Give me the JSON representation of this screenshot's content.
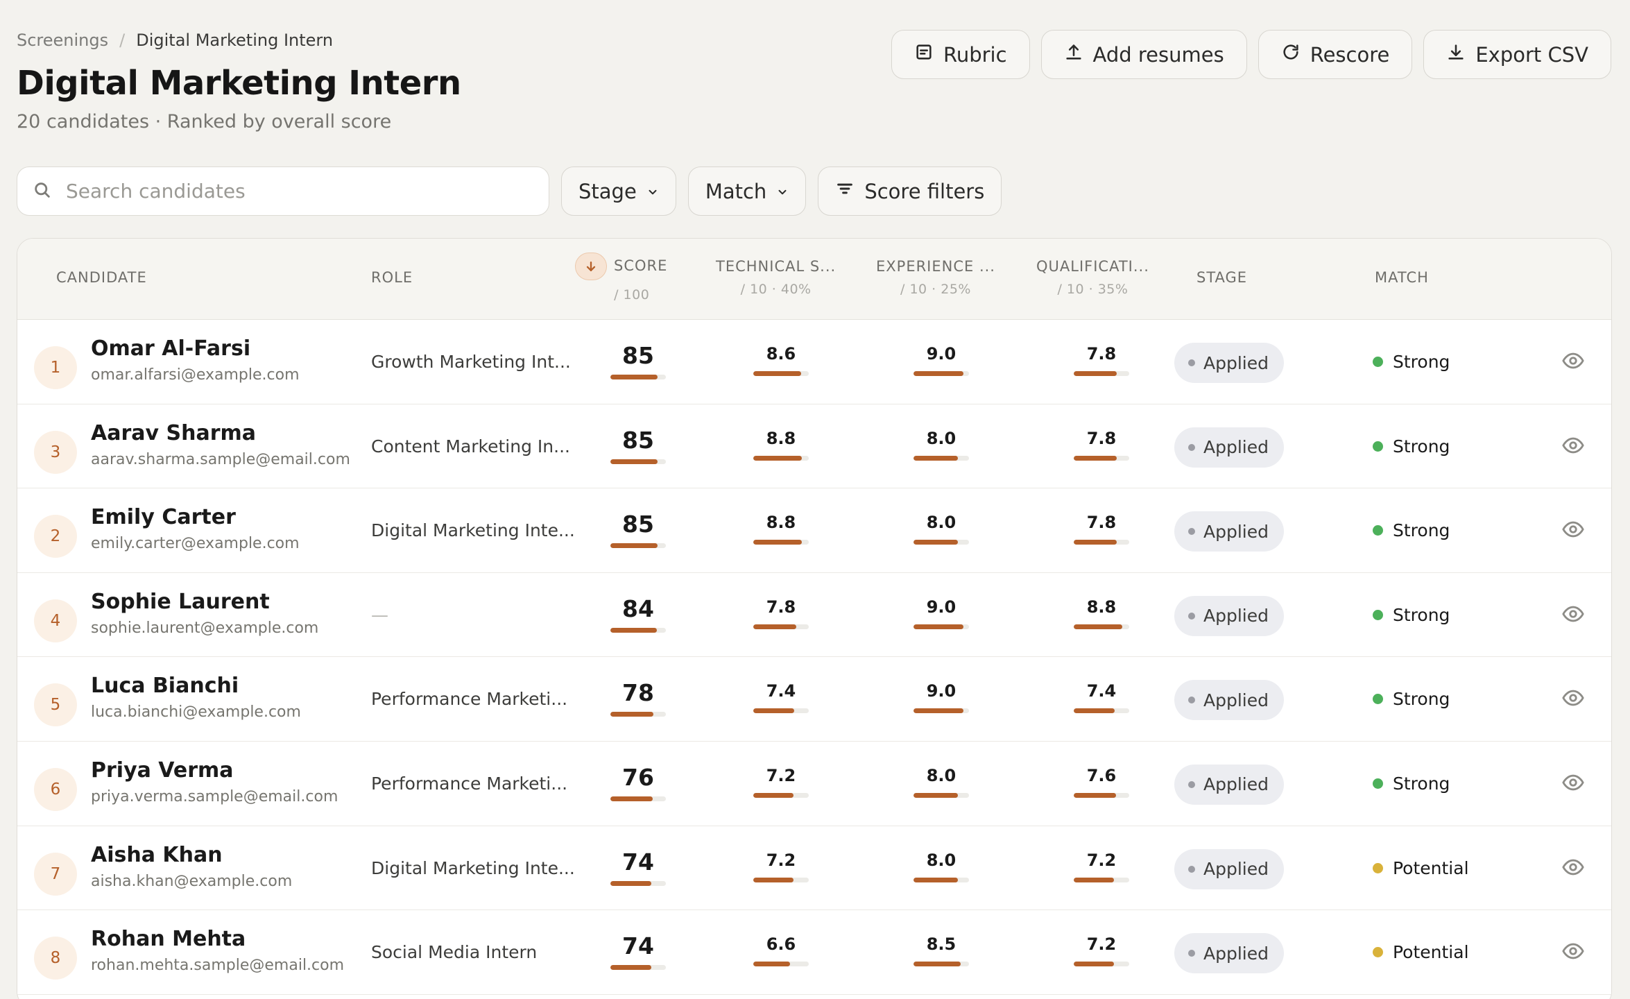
{
  "breadcrumb": {
    "root": "Screenings",
    "separator": "/",
    "current": "Digital Marketing Intern"
  },
  "page": {
    "title": "Digital Marketing Intern",
    "subtitle": "20 candidates · Ranked by overall score"
  },
  "actions": {
    "rubric": "Rubric",
    "add_resumes": "Add resumes",
    "rescore": "Rescore",
    "export_csv": "Export CSV"
  },
  "filters": {
    "search_placeholder": "Search candidates",
    "stage": "Stage",
    "match": "Match",
    "score_filters": "Score filters"
  },
  "columns": {
    "candidate": "CANDIDATE",
    "role": "ROLE",
    "score": "SCORE",
    "score_sub": "/ 100",
    "technical": "TECHNICAL S...",
    "technical_sub": "/ 10 · 40%",
    "experience": "EXPERIENCE ...",
    "experience_sub": "/ 10 · 25%",
    "qualifications": "QUALIFICATI...",
    "qualifications_sub": "/ 10 · 35%",
    "stage": "STAGE",
    "match": "MATCH"
  },
  "colors": {
    "accent": "#b5602a",
    "strong": "#4cb05a",
    "potential": "#d9b23a",
    "background": "#f3f2ee"
  },
  "icons": {
    "sort": "arrow-down-icon",
    "view": "eye-icon",
    "search": "search-icon"
  },
  "rows": [
    {
      "rank": "1",
      "name": "Omar Al-Farsi",
      "email": "omar.alfarsi@example.com",
      "role": "Growth Marketing Int...",
      "score": "85",
      "technical": "8.6",
      "experience": "9.0",
      "qualifications": "7.8",
      "stage": "Applied",
      "match": "Strong"
    },
    {
      "rank": "3",
      "name": "Aarav Sharma",
      "email": "aarav.sharma.sample@email.com",
      "role": "Content Marketing In...",
      "score": "85",
      "technical": "8.8",
      "experience": "8.0",
      "qualifications": "7.8",
      "stage": "Applied",
      "match": "Strong"
    },
    {
      "rank": "2",
      "name": "Emily Carter",
      "email": "emily.carter@example.com",
      "role": "Digital Marketing Inte...",
      "score": "85",
      "technical": "8.8",
      "experience": "8.0",
      "qualifications": "7.8",
      "stage": "Applied",
      "match": "Strong"
    },
    {
      "rank": "4",
      "name": "Sophie Laurent",
      "email": "sophie.laurent@example.com",
      "role": "—",
      "score": "84",
      "technical": "7.8",
      "experience": "9.0",
      "qualifications": "8.8",
      "stage": "Applied",
      "match": "Strong"
    },
    {
      "rank": "5",
      "name": "Luca Bianchi",
      "email": "luca.bianchi@example.com",
      "role": "Performance Marketi...",
      "score": "78",
      "technical": "7.4",
      "experience": "9.0",
      "qualifications": "7.4",
      "stage": "Applied",
      "match": "Strong"
    },
    {
      "rank": "6",
      "name": "Priya Verma",
      "email": "priya.verma.sample@email.com",
      "role": "Performance Marketi...",
      "score": "76",
      "technical": "7.2",
      "experience": "8.0",
      "qualifications": "7.6",
      "stage": "Applied",
      "match": "Strong"
    },
    {
      "rank": "7",
      "name": "Aisha Khan",
      "email": "aisha.khan@example.com",
      "role": "Digital Marketing Inte...",
      "score": "74",
      "technical": "7.2",
      "experience": "8.0",
      "qualifications": "7.2",
      "stage": "Applied",
      "match": "Potential"
    },
    {
      "rank": "8",
      "name": "Rohan Mehta",
      "email": "rohan.mehta.sample@email.com",
      "role": "Social Media Intern",
      "score": "74",
      "technical": "6.6",
      "experience": "8.5",
      "qualifications": "7.2",
      "stage": "Applied",
      "match": "Potential"
    }
  ]
}
